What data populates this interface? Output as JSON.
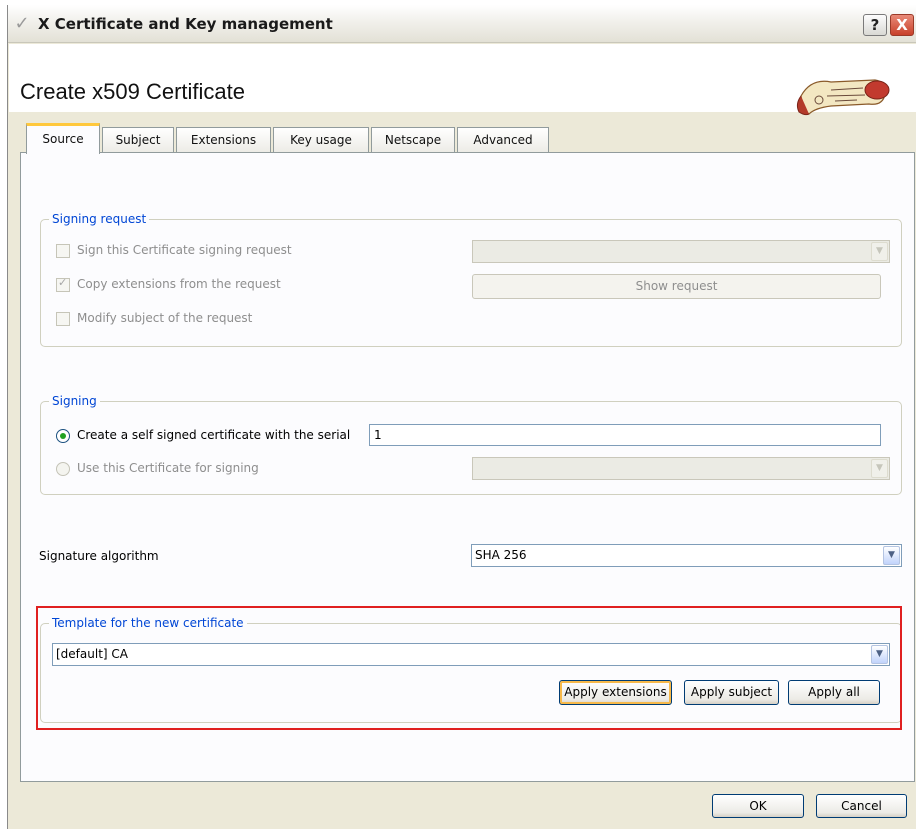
{
  "window": {
    "title": "X Certificate and Key management",
    "help_label": "?",
    "close_label": "X",
    "app_icon": "check-mark-icon"
  },
  "dialog": {
    "title": "Create x509 Certificate"
  },
  "tabs": [
    {
      "label": "Source",
      "active": true
    },
    {
      "label": "Subject"
    },
    {
      "label": "Extensions"
    },
    {
      "label": "Key usage"
    },
    {
      "label": "Netscape"
    },
    {
      "label": "Advanced"
    }
  ],
  "signing_request": {
    "legend": "Signing request",
    "sign_csr_label": "Sign this Certificate signing request",
    "sign_csr_checked": false,
    "sign_csr_select": "",
    "copy_ext_label": "Copy extensions from the request",
    "copy_ext_checked": true,
    "show_request_label": "Show request",
    "modify_subject_label": "Modify subject of the request",
    "modify_subject_checked": false
  },
  "signing": {
    "legend": "Signing",
    "self_signed_label": "Create a self signed certificate with the serial",
    "serial_value": "1",
    "use_ca_label": "Use this Certificate for signing",
    "use_ca_select": ""
  },
  "signature": {
    "label": "Signature algorithm",
    "value": "SHA 256"
  },
  "template": {
    "legend": "Template for the new certificate",
    "value": "[default] CA",
    "apply_extensions_label": "Apply extensions",
    "apply_subject_label": "Apply subject",
    "apply_all_label": "Apply all"
  },
  "footer": {
    "ok_label": "OK",
    "cancel_label": "Cancel"
  },
  "colors": {
    "window_bg": "#ece9d8",
    "panel_bg": "#fcfcfe",
    "legend_text": "#0046d5",
    "highlight": "#e02020"
  }
}
